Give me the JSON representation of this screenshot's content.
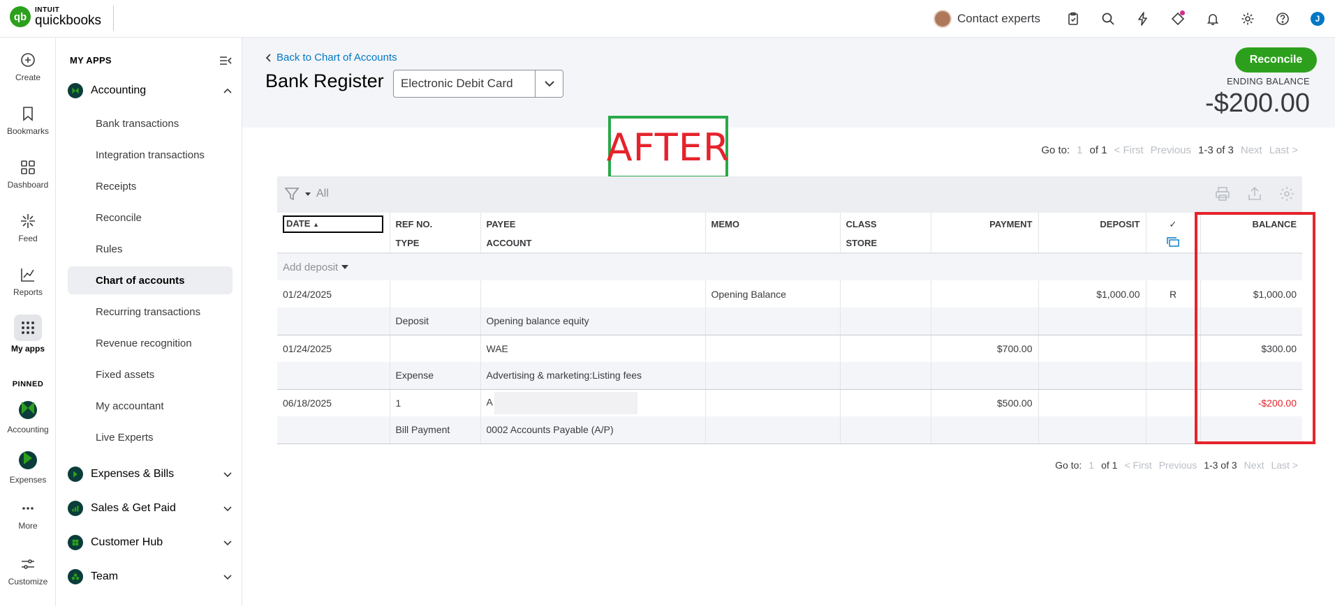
{
  "topbar": {
    "logo_brand": "INTUIT",
    "logo_product": "quickbooks",
    "contact_experts": "Contact experts",
    "user_initial": "J",
    "icons": [
      "clipboard-icon",
      "search-icon",
      "lightning-icon",
      "flag-icon",
      "bell-icon",
      "gear-icon",
      "help-icon"
    ]
  },
  "rail": {
    "create": "Create",
    "bookmarks": "Bookmarks",
    "dashboard": "Dashboard",
    "feed": "Feed",
    "reports": "Reports",
    "my_apps": "My apps",
    "pinned": "PINNED",
    "accounting": "Accounting",
    "expenses": "Expenses",
    "more": "More",
    "customize": "Customize"
  },
  "apps": {
    "header": "MY APPS",
    "accounting": "Accounting",
    "items": [
      "Bank transactions",
      "Integration transactions",
      "Receipts",
      "Reconcile",
      "Rules",
      "Chart of accounts",
      "Recurring transactions",
      "Revenue recognition",
      "Fixed assets",
      "My accountant",
      "Live Experts"
    ],
    "groups": [
      "Expenses & Bills",
      "Sales & Get Paid",
      "Customer Hub",
      "Team"
    ]
  },
  "header": {
    "back": "Back to Chart of Accounts",
    "title": "Bank Register",
    "account": "Electronic Debit Card",
    "reconcile": "Reconcile",
    "ending_label": "ENDING BALANCE",
    "ending_value": "-$200.00"
  },
  "annotation": {
    "after": "AFTER"
  },
  "pager": {
    "goto": "Go to:",
    "page": "1",
    "of": "of 1",
    "first": "< First",
    "previous": "Previous",
    "range": "1-3 of 3",
    "next": "Next",
    "last": "Last >"
  },
  "filter": {
    "label": "All"
  },
  "columns": {
    "date": "DATE",
    "ref": "REF NO.",
    "type": "TYPE",
    "payee": "PAYEE",
    "account": "ACCOUNT",
    "memo": "MEMO",
    "class": "CLASS",
    "store": "STORE",
    "payment": "PAYMENT",
    "deposit": "DEPOSIT",
    "check": "✓",
    "balance": "BALANCE"
  },
  "add_deposit": "Add deposit",
  "rows": [
    {
      "date": "01/24/2025",
      "ref": "",
      "payee": "",
      "memo": "Opening Balance",
      "payment": "",
      "deposit": "$1,000.00",
      "status": "R",
      "balance": "$1,000.00",
      "type": "Deposit",
      "account": "Opening balance equity"
    },
    {
      "date": "01/24/2025",
      "ref": "",
      "payee": "WAE",
      "memo": "",
      "payment": "$700.00",
      "deposit": "",
      "status": "",
      "balance": "$300.00",
      "type": "Expense",
      "account": "Advertising & marketing:Listing fees"
    },
    {
      "date": "06/18/2025",
      "ref": "1",
      "payee": "A",
      "memo": "",
      "payment": "$500.00",
      "deposit": "",
      "status": "",
      "balance": "-$200.00",
      "type": "Bill Payment",
      "account": "0002 Accounts Payable (A/P)"
    }
  ]
}
